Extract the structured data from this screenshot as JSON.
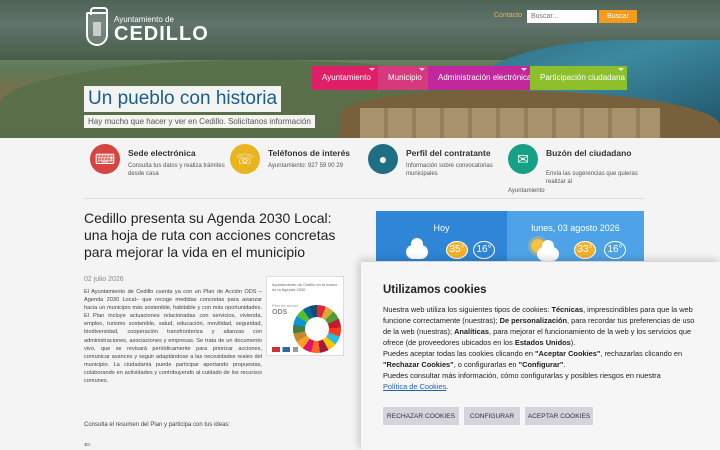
{
  "header": {
    "logo_sub": "Ayuntamiento de",
    "logo_name": "CEDILLO",
    "contact_label": "Contacto",
    "search_placeholder": "Buscar...",
    "search_button": "Buscar"
  },
  "nav": {
    "items": [
      {
        "label": "Ayuntamiento"
      },
      {
        "label": "Municipio"
      },
      {
        "label": "Administración electrónica"
      },
      {
        "label": "Participación ciudadana"
      }
    ]
  },
  "hero": {
    "slogan": "Un pueblo con historia",
    "subslogan": "Hay mucho que hacer y ver en Cedillo. Solicítanos información"
  },
  "services": [
    {
      "title": "Sede electrónica",
      "desc": "Consulta tus datos y realiza trámites desde casa",
      "icon": "keyboard-icon"
    },
    {
      "title": "Teléfonos de interés",
      "desc": "Ayuntamiento: 927 59 00 29",
      "icon": "phone-icon"
    },
    {
      "title": "Perfil del contratante",
      "desc": "Información sobre convocatorias municipales",
      "icon": "user-icon"
    },
    {
      "title": "Buzón del ciudadano",
      "desc": "Envía las sugerencias que quieras realizar al",
      "desc2": "Ayuntamiento",
      "icon": "mail-icon"
    }
  ],
  "article": {
    "title": "Cedillo presenta su Agenda 2030 Local: una hoja de ruta con acciones concretas para mejorar la vida en el municipio",
    "date": "02 julio 2026",
    "body": "El Ayuntamiento de Cedillo cuenta ya con un Plan de Acción ODS –Agenda 2030 Local– que recoge medidas concretas para avanzar hacia un municipio más sostenible, habitable y con más oportunidades. El Plan incluye actuaciones relacionadas con servicios, vivienda, empleo, turismo sostenible, salud, educación, movilidad, seguridad, biodiversidad, cooperación transfronteriza y alianzas con administraciones, asociaciones y empresas. Se trata de un documento vivo, que se revisará periódicamente para priorizar acciones, comunicar avances y seguir adaptándose a las necesidades reales del municipio. La ciudadanía puede participar aportando propuestas, colaborando en actividades y contribuyendo al cuidado de los recursos comunes.",
    "footer": "Consulta el resumen del Plan y participa con tus ideas:",
    "arrow": "⇐",
    "poster_title": "Ayuntamiento de Cedillo en el marco de la Agenda 2030",
    "poster_ods_small": "Plan de acción",
    "poster_ods": "ODS"
  },
  "weather": {
    "today_label": "Hoy",
    "today_hi": "35°",
    "today_lo": "16°",
    "next_label": "lunes, 03 agosto 2026",
    "next_hi": "33°",
    "next_lo": "16°"
  },
  "cookies": {
    "title": "Utilizamos cookies",
    "p1_a": "Nuestra web utiliza los siguientes tipos de cookies: ",
    "p1_b": "Técnicas",
    "p1_c": ", imprescindibles para que la web funcione correctamente (nuestras); ",
    "p1_d": "De personalización",
    "p1_e": ", para recordar tus preferencias de uso de la web (nuestras); ",
    "p1_f": "Analíticas",
    "p1_g": ", para mejorar el funcionamiento de la web y los servicios que ofrece (de proveedores ubicados en los ",
    "p1_h": "Estados Unidos",
    "p1_i": ").",
    "p2_a": "Puedes aceptar todas las cookies clicando en ",
    "p2_b": "\"Aceptar Cookies\"",
    "p2_c": ", rechazarlas clicando en ",
    "p2_d": "\"Rechazar Cookies\"",
    "p2_e": ", o configurarlas en ",
    "p2_f": "\"Configurar\"",
    "p2_g": ".",
    "p3": "Puedes consultar más información, cómo configurarlas y posibles riesgos en nuestra",
    "p3_link": "Política de Cookies",
    "p3_end": ".",
    "reject": "RECHAZAR COOKIES",
    "configure": "CONFIGURAR",
    "accept": "ACEPTAR COOKIES"
  }
}
